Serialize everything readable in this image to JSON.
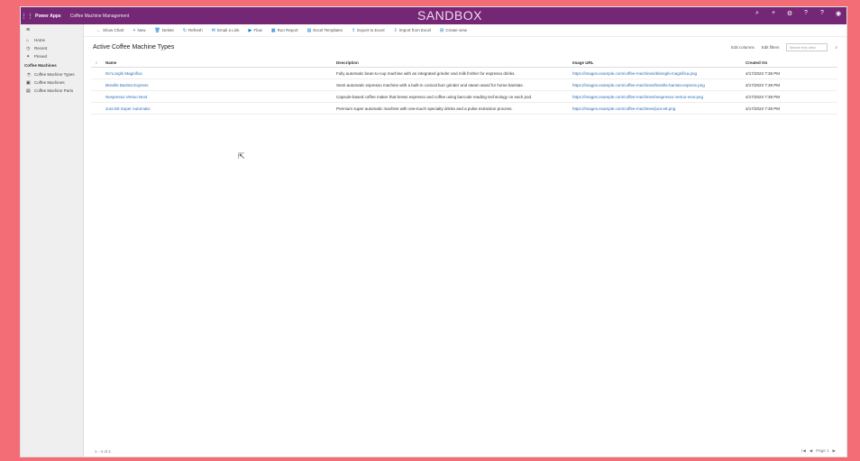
{
  "topbar": {
    "app_name": "Power Apps",
    "area_name": "Coffee Machine Management",
    "environment": "SANDBOX",
    "icons": [
      "search-icon",
      "add-icon",
      "settings-icon",
      "help-icon",
      "question-icon",
      "avatar"
    ]
  },
  "sidebar": {
    "menu_icon": "≡",
    "items": [
      {
        "icon": "⌂",
        "label": "Home"
      },
      {
        "icon": "◷",
        "label": "Recent"
      },
      {
        "icon": "✶",
        "label": "Pinned"
      }
    ],
    "group_label": "Coffee Machines",
    "entities": [
      {
        "icon": "☕",
        "label": "Coffee Machine Types"
      },
      {
        "icon": "▣",
        "label": "Coffee Machines"
      },
      {
        "icon": "▤",
        "label": "Coffee Machine Parts"
      }
    ]
  },
  "commands": [
    {
      "icon": "←",
      "label": "Show Chart"
    },
    {
      "icon": "+",
      "label": "New"
    },
    {
      "icon": "🗑",
      "label": "Delete"
    },
    {
      "icon": "↻",
      "label": "Refresh"
    },
    {
      "icon": "✉",
      "label": "Email a Link"
    },
    {
      "icon": "▶",
      "label": "Flow"
    },
    {
      "icon": "▦",
      "label": "Run Report"
    },
    {
      "icon": "▤",
      "label": "Excel Templates"
    },
    {
      "icon": "⇪",
      "label": "Export to Excel"
    },
    {
      "icon": "⇩",
      "label": "Import from Excel"
    },
    {
      "icon": "⊞",
      "label": "Create view"
    }
  ],
  "view": {
    "title": "Active Coffee Machine Types",
    "edit_columns": "Edit columns",
    "edit_filters": "Edit filters",
    "search_placeholder": "Search this view"
  },
  "grid": {
    "columns": [
      "Name",
      "Description",
      "Image URL",
      "Created On"
    ],
    "rows": [
      {
        "name": "De'Longhi Magnifica",
        "description": "Fully automatic bean-to-cup machine with an integrated grinder and milk frother for espresso drinks.",
        "image_url": "https://images.example.com/coffee-machines/delonghi-magnifica.png",
        "created": "4/17/2023 7:38 PM"
      },
      {
        "name": "Breville Barista Express",
        "description": "Semi-automatic espresso machine with a built-in conical burr grinder and steam wand for home baristas.",
        "image_url": "https://images.example.com/coffee-machines/breville-barista-express.png",
        "created": "4/17/2023 7:38 PM"
      },
      {
        "name": "Nespresso Vertuo Next",
        "description": "Capsule-based coffee maker that brews espresso and coffee using barcode reading technology on each pod.",
        "image_url": "https://images.example.com/coffee-machines/nespresso-vertuo-next.png",
        "created": "4/17/2023 7:38 PM"
      },
      {
        "name": "Jura E8 Super Automatic",
        "description": "Premium super automatic machine with one-touch specialty drinks and a pulse extraction process.",
        "image_url": "https://images.example.com/coffee-machines/jura-e8.png",
        "created": "4/17/2023 7:38 PM"
      }
    ]
  },
  "footer": {
    "count": "1 - 4 of 4",
    "page_label": "Page 1"
  },
  "colors": {
    "accent": "#742774",
    "link": "#2a6ebb",
    "border": "#f26d75"
  }
}
